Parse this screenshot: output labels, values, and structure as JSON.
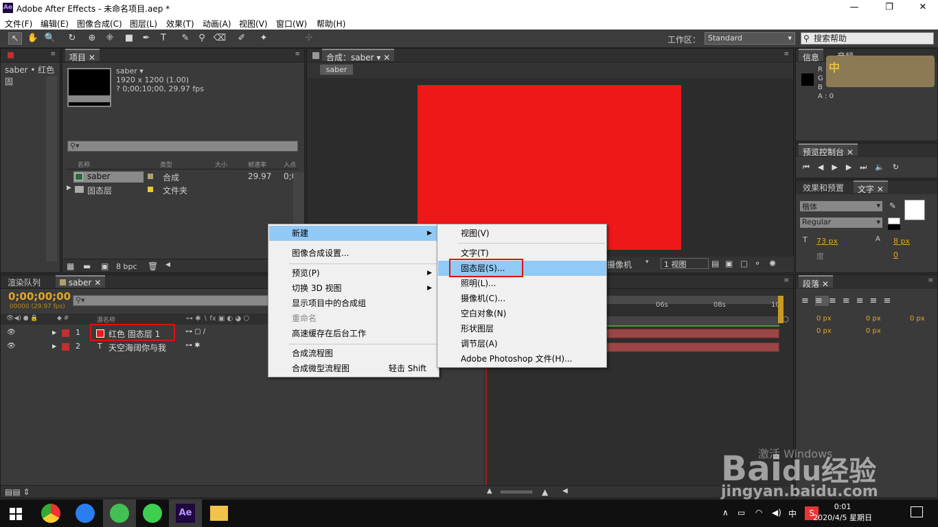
{
  "window": {
    "title": "Adobe After Effects - 未命名项目.aep *",
    "logo": "Ae"
  },
  "menu": [
    "文件(F)",
    "编辑(E)",
    "图像合成(C)",
    "图层(L)",
    "效果(T)",
    "动画(A)",
    "视图(V)",
    "窗口(W)",
    "帮助(H)"
  ],
  "toolbar": {
    "workspace_label": "工作区：",
    "workspace_value": "Standard",
    "search_help_placeholder": "搜索帮助"
  },
  "project_panel": {
    "tab": "项目",
    "left_tab_text": "saber • 红色 固",
    "comp_name": "saber ▾",
    "comp_size": "1920 x 1200 (1.00)",
    "comp_duration": "? 0;00;10;00, 29.97 fps",
    "columns": [
      "名称",
      "类型",
      "大小",
      "帧速率",
      "入点"
    ],
    "items": [
      {
        "name": "saber",
        "type": "合成",
        "fps": "29.97",
        "in": "0;0",
        "color": "#b0a070"
      },
      {
        "name": "固态层",
        "type": "文件夹",
        "fps": "",
        "in": "",
        "color": "#e6cc30"
      }
    ],
    "bpc": "8 bpc"
  },
  "comp_panel": {
    "tab": "合成：saber",
    "name_tab": "saber",
    "camera": "摄像机",
    "views": "1 视图",
    "solid_color": "#ee1818"
  },
  "timeline": {
    "render_tab": "渲染队列",
    "comp_tab": "saber",
    "timecode": "0;00;00;00",
    "fps": "00000 (29.97 fps)",
    "col_name": "源名称",
    "layers": [
      {
        "num": "1",
        "name": "红色 固态层 1",
        "color": "#c03030"
      },
      {
        "num": "2",
        "name": "天空海阔你与我",
        "color": "#c03030"
      }
    ],
    "ruler": [
      "06s",
      "08s",
      "10s"
    ]
  },
  "context_menu": {
    "items": [
      {
        "label": "新建",
        "submenu": true,
        "highlight": true
      },
      {
        "label": "图像合成设置..."
      },
      {
        "label": "预览(P)",
        "submenu": true
      },
      {
        "label": "切换 3D 视图",
        "submenu": true
      },
      {
        "label": "显示项目中的合成组"
      },
      {
        "label": "重命名",
        "disabled": true
      },
      {
        "label": "高速缓存在后台工作"
      },
      {
        "label": "合成流程图"
      },
      {
        "label": "合成微型流程图",
        "shortcut": "轻击 Shift"
      }
    ]
  },
  "submenu": {
    "items": [
      {
        "label": "视图(V)"
      },
      {
        "label": "文字(T)"
      },
      {
        "label": "固态层(S)...",
        "highlight": true
      },
      {
        "label": "照明(L)..."
      },
      {
        "label": "摄像机(C)..."
      },
      {
        "label": "空白对象(N)"
      },
      {
        "label": "形状图层"
      },
      {
        "label": "调节层(A)"
      },
      {
        "label": "Adobe Photoshop 文件(H)..."
      }
    ]
  },
  "info_panel": {
    "tab": "信息",
    "tab2": "音频",
    "r": "R",
    "g": "G",
    "b": "B",
    "a": "A : 0"
  },
  "preview_panel": {
    "tab": "预览控制台"
  },
  "text_panel": {
    "tab1": "效果和预置",
    "tab2": "文字",
    "font": "楷体",
    "style": "Regular",
    "size": "73 px",
    "leading": "8 px",
    "tracking_label": "度",
    "tracking": "0"
  },
  "para_panel": {
    "tab": "段落",
    "v1": "0 px",
    "v2": "0 px",
    "v3": "0 px",
    "v4": "0 px",
    "v5": "0 px"
  },
  "taskbar": {
    "time": "0:01",
    "date": "2020/4/5 星期日",
    "ime": "中"
  },
  "watermark": {
    "activate": "激活 Windows",
    "brand": "Bai",
    "paw": "du",
    "cn": "经验",
    "url": "jingyan.baidu.com"
  }
}
